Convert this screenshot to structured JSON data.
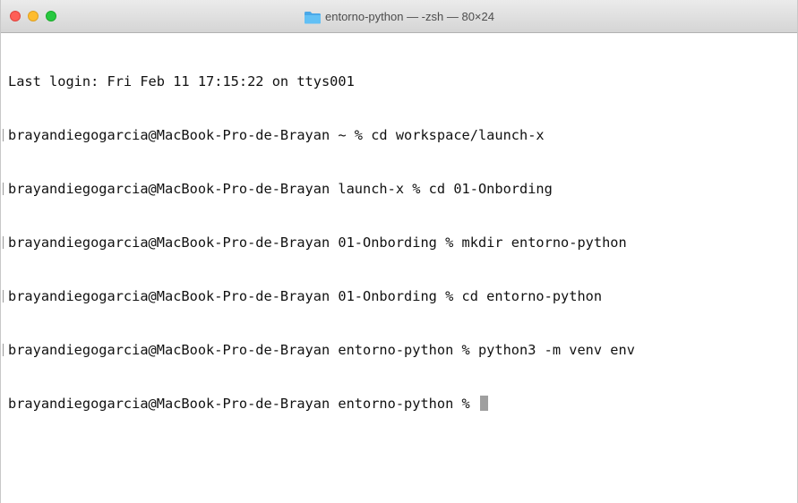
{
  "window": {
    "title": "entorno-python — -zsh — 80×24",
    "title_icon": "folder-icon"
  },
  "colors": {
    "close": "#fe5f57",
    "minimize": "#febc2e",
    "zoom": "#28c840",
    "folder": "#4aa8e8"
  },
  "terminal": {
    "lines": [
      "Last login: Fri Feb 11 17:15:22 on ttys001",
      "brayandiegogarcia@MacBook-Pro-de-Brayan ~ % cd workspace/launch-x",
      "brayandiegogarcia@MacBook-Pro-de-Brayan launch-x % cd 01-Onbording",
      "brayandiegogarcia@MacBook-Pro-de-Brayan 01-Onbording % mkdir entorno-python",
      "brayandiegogarcia@MacBook-Pro-de-Brayan 01-Onbording % cd entorno-python",
      "brayandiegogarcia@MacBook-Pro-de-Brayan entorno-python % python3 -m venv env",
      "brayandiegogarcia@MacBook-Pro-de-Brayan entorno-python % "
    ]
  }
}
